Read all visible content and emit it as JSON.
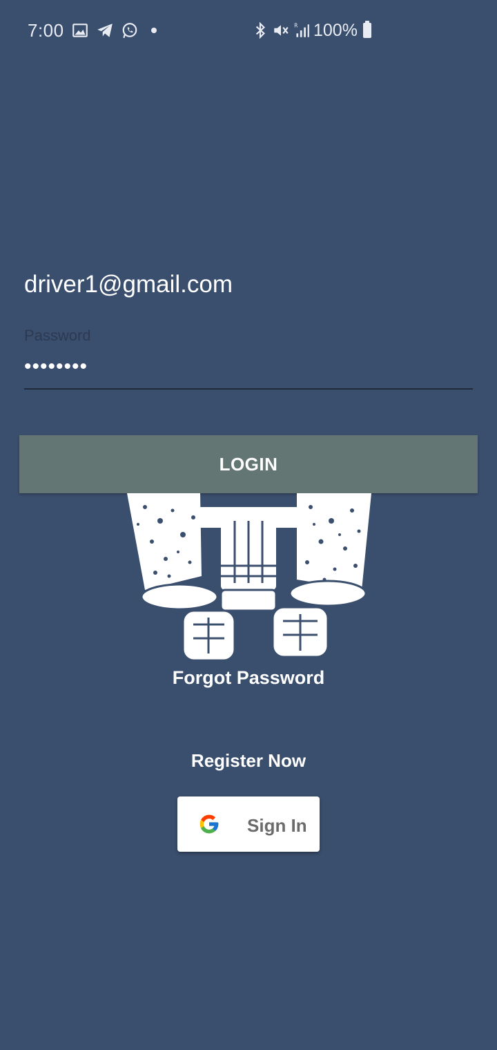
{
  "status_bar": {
    "time": "7:00",
    "battery": "100%",
    "icons": [
      "gallery-icon",
      "telegram-icon",
      "whatsapp-icon",
      "notification-dot-icon",
      "bluetooth-icon",
      "mute-icon",
      "signal-icon",
      "battery-icon"
    ]
  },
  "login_form": {
    "email_value": "driver1@gmail.com",
    "password_label": "Password",
    "password_value": "••••••••",
    "login_label": "LOGIN"
  },
  "links": {
    "forgot_password": "Forgot Password",
    "register_now": "Register Now"
  },
  "google_button": {
    "label": "Sign In",
    "icon": "google-icon"
  },
  "colors": {
    "background": "#3a4e6d",
    "login_button": "#647674",
    "text": "#ffffff"
  }
}
